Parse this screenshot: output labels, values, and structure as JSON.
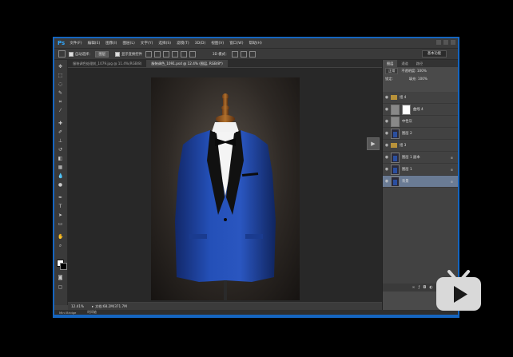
{
  "app": {
    "logo": "Ps",
    "menu": [
      "文件(F)",
      "编辑(E)",
      "图像(I)",
      "图层(L)",
      "文字(Y)",
      "选择(S)",
      "滤镜(T)",
      "3D(D)",
      "视图(V)",
      "窗口(W)",
      "帮助(H)"
    ]
  },
  "options": {
    "auto_select_label": "自动选择：",
    "auto_select_value": "图层",
    "show_transform_label": "显示变换控件",
    "mode_3d_label": "3D 模式：",
    "workspace_label": "基本功能"
  },
  "tabs": [
    {
      "label": "服装调色处理前_1079.jpg @ 11.4%(RGB/8)",
      "active": false
    },
    {
      "label": "服装调色_1091.psd @ 12.4% (图层, RGB/8*)",
      "active": true
    }
  ],
  "status": {
    "zoom": "12.41%",
    "doc": "文档:68.2M/371.7M"
  },
  "bottom": {
    "mini_bridge": "Mini Bridge",
    "timeline": "时间轴"
  },
  "panel": {
    "tabs": [
      "图层",
      "通道",
      "路径"
    ],
    "blend_mode": "正常",
    "opacity_label": "不透明度: 100%",
    "lock_label": "锁定:",
    "fill_label": "填充: 100%"
  },
  "layers": [
    {
      "name": "组 4",
      "type": "group"
    },
    {
      "name": "曲线 4",
      "type": "adjustment"
    },
    {
      "name": "中性灰",
      "type": "gray"
    },
    {
      "name": "图层 2",
      "type": "image"
    },
    {
      "name": "组 3",
      "type": "group"
    },
    {
      "name": "图层 1 副本",
      "type": "image"
    },
    {
      "name": "图层 1",
      "type": "image"
    },
    {
      "name": "背景",
      "type": "image",
      "selected": true
    }
  ],
  "colors": {
    "accent": "#31a8ff",
    "frame": "#1565c0",
    "bili_badge": "#d9d9d9"
  }
}
